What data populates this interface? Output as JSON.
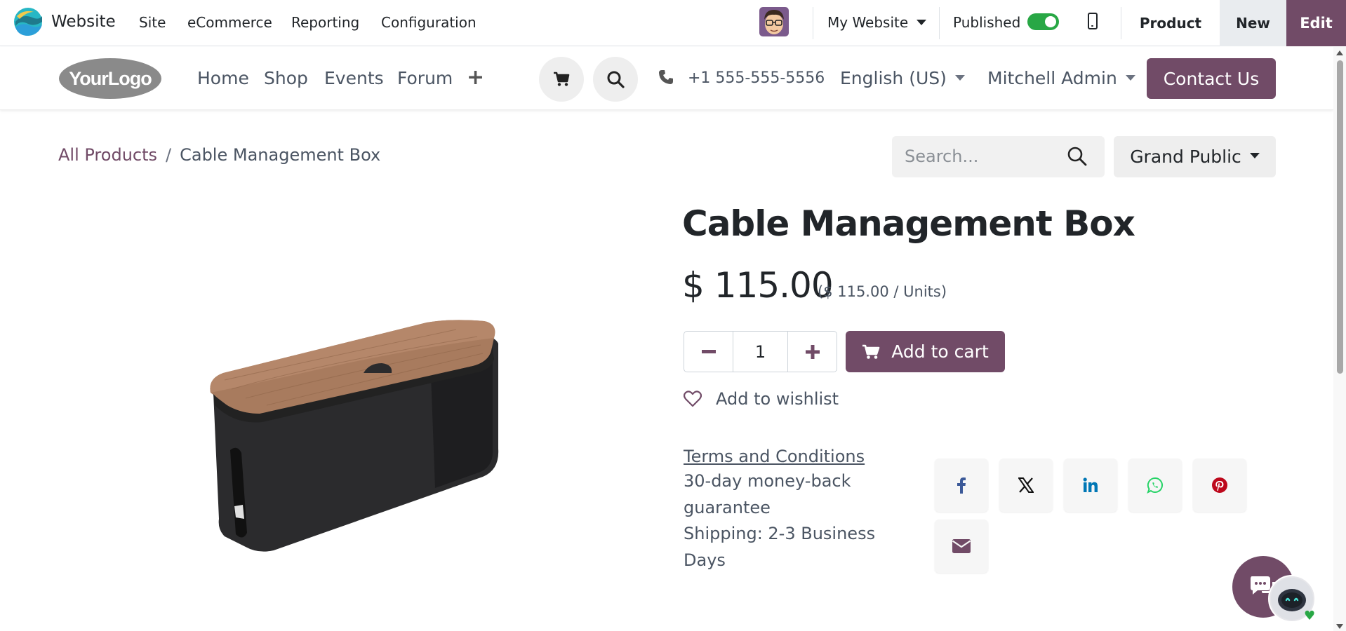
{
  "admin_bar": {
    "app_name": "Website",
    "menu": [
      "Site",
      "eCommerce",
      "Reporting",
      "Configuration"
    ],
    "website_selector": "My Website",
    "published_label": "Published",
    "published": true,
    "product_label": "Product",
    "new_label": "New",
    "edit_label": "Edit"
  },
  "site_header": {
    "logo_text": "YourLogo",
    "nav": [
      "Home",
      "Shop",
      "Events",
      "Forum"
    ],
    "phone": "+1 555-555-5556",
    "language": "English (US)",
    "user": "Mitchell Admin",
    "contact_label": "Contact Us"
  },
  "breadcrumb": {
    "parent": "All Products",
    "separator": "/",
    "current": "Cable Management Box"
  },
  "search": {
    "placeholder": "Search..."
  },
  "pricelist": "Grand Public",
  "product": {
    "name": "Cable Management Box",
    "price": "$ 115.00",
    "unit_price": "($ 115.00 / Units)",
    "quantity": "1",
    "add_to_cart": "Add to cart",
    "wishlist": "Add to wishlist",
    "terms": "Terms and Conditions",
    "guarantee_line1": "30-day money-back",
    "guarantee_line2": "guarantee",
    "shipping_line1": "Shipping: 2-3 Business",
    "shipping_line2": "Days"
  },
  "share_icons": [
    "facebook-icon",
    "x-icon",
    "linkedin-icon",
    "whatsapp-icon",
    "pinterest-icon",
    "email-icon"
  ],
  "colors": {
    "brand": "#714b67",
    "toggle_on": "#28a745",
    "facebook": "#3b5998",
    "linkedin": "#0077b5",
    "whatsapp": "#25d366",
    "pinterest": "#bd081c"
  }
}
